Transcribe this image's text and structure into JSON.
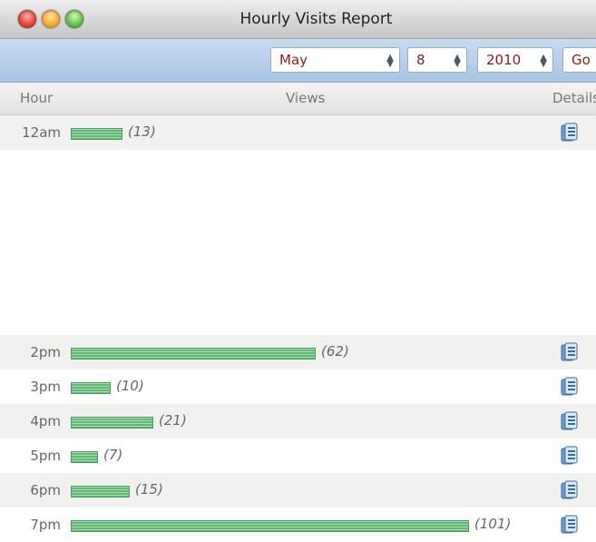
{
  "window": {
    "title": "Hourly Visits Report"
  },
  "toolbar": {
    "month": "May",
    "day": "8",
    "year": "2010",
    "go_label": "Go"
  },
  "table": {
    "headers": {
      "hour": "Hour",
      "views": "Views",
      "details": "Details"
    },
    "rows": [
      {
        "hour": "12am",
        "views": 13,
        "label": "(13)"
      },
      {
        "hour": "2pm",
        "views": 62,
        "label": "(62)"
      },
      {
        "hour": "3pm",
        "views": 10,
        "label": "(10)"
      },
      {
        "hour": "4pm",
        "views": 21,
        "label": "(21)"
      },
      {
        "hour": "5pm",
        "views": 7,
        "label": "(7)"
      },
      {
        "hour": "6pm",
        "views": 15,
        "label": "(15)"
      },
      {
        "hour": "7pm",
        "views": 101,
        "label": "(101)"
      }
    ]
  },
  "colors": {
    "bar": "#63b877",
    "toolbar": "#a8c4e4",
    "select_text": "#8b1a1a"
  },
  "icons": {
    "detail": "document-detail-icon"
  }
}
